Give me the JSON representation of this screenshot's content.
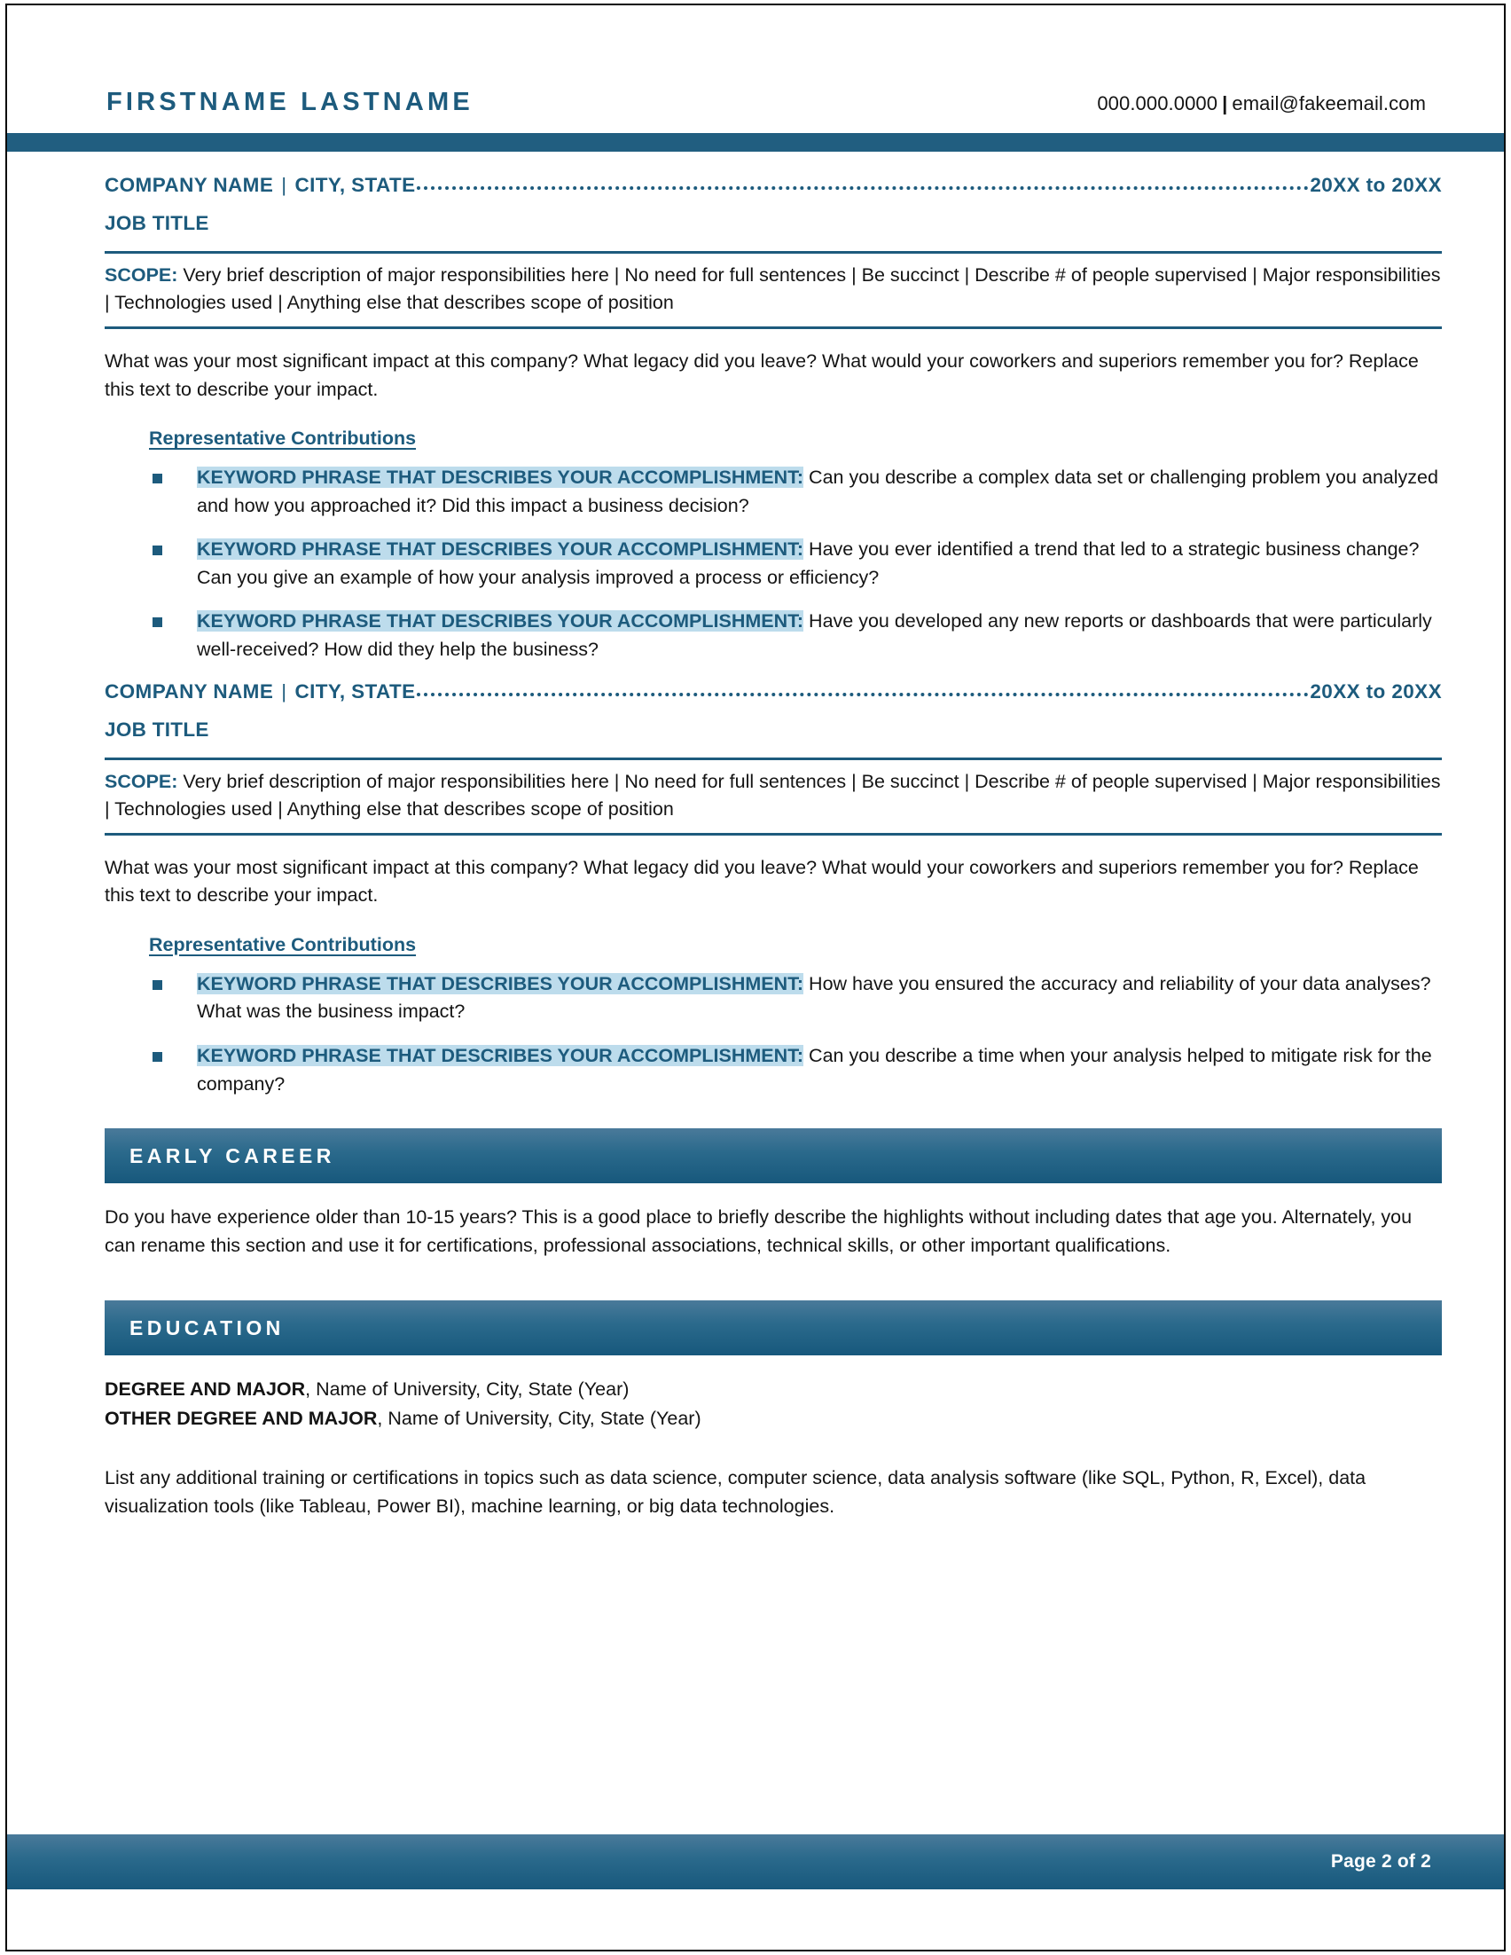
{
  "header": {
    "full_name": "FIRSTNAME LASTNAME",
    "phone": "000.000.0000",
    "separator": "|",
    "email": "email@fakeemail.com",
    "accent_color": "#215e80"
  },
  "jobs": [
    {
      "company_name": "COMPANY NAME",
      "pipe": "|",
      "city_state": "CITY, STATE",
      "dates": "20XX to 20XX",
      "job_title": "JOB TITLE",
      "scope_label": "SCOPE:",
      "scope_text": " Very brief description of major responsibilities here | No need for full sentences | Be succinct | Describe # of people supervised | Major responsibilities | Technologies used | Anything else that describes scope of position",
      "impact_paragraph": "What was your most significant impact at this company? What legacy did you leave? What would your coworkers and superiors remember you for? Replace this text to describe your impact.",
      "contributions_heading": "Representative Contributions",
      "bullets": [
        {
          "keyword": "KEYWORD PHRASE THAT DESCRIBES YOUR ACCOMPLISHMENT:",
          "text": " Can you describe a complex data set or challenging problem you analyzed and how you approached it? Did this impact a business decision?"
        },
        {
          "keyword": "KEYWORD PHRASE THAT DESCRIBES YOUR ACCOMPLISHMENT:",
          "text": " Have you ever identified a trend that led to a strategic business change? Can you give an example of how your analysis improved a process or efficiency?"
        },
        {
          "keyword": "KEYWORD PHRASE THAT DESCRIBES YOUR ACCOMPLISHMENT:",
          "text": " Have you developed any new reports or dashboards that were particularly well-received? How did they help the business?"
        }
      ]
    },
    {
      "company_name": "COMPANY NAME",
      "pipe": "|",
      "city_state": "CITY, STATE",
      "dates": "20XX to 20XX",
      "job_title": "JOB TITLE",
      "scope_label": "SCOPE:",
      "scope_text": " Very brief description of major responsibilities here | No need for full sentences | Be succinct | Describe # of people supervised | Major responsibilities | Technologies used | Anything else that describes scope of position",
      "impact_paragraph": "What was your most significant impact at this company? What legacy did you leave? What would your coworkers and superiors remember you for? Replace this text to describe your impact.",
      "contributions_heading": "Representative Contributions",
      "bullets": [
        {
          "keyword": "KEYWORD PHRASE THAT DESCRIBES YOUR ACCOMPLISHMENT:",
          "text": " How have you ensured the accuracy and reliability of your data analyses? What was the business impact?"
        },
        {
          "keyword": "KEYWORD PHRASE THAT DESCRIBES YOUR ACCOMPLISHMENT:",
          "text": " Can you describe a time when your analysis helped to mitigate risk for the company?"
        }
      ]
    }
  ],
  "early_career": {
    "title": "EARLY CAREER",
    "body": "Do you have experience older than 10-15 years? This is a good place to briefly describe the highlights without including dates that age you. Alternately, you can rename this section and use it for certifications, professional associations, technical skills, or other important qualifications."
  },
  "education": {
    "title": "EDUCATION",
    "entries": [
      {
        "degree": "DEGREE AND MAJOR",
        "detail": ", Name of University, City, State (Year)"
      },
      {
        "degree": "OTHER DEGREE AND MAJOR",
        "detail": ", Name of University, City, State (Year)"
      }
    ],
    "note": "List any additional training or certifications  in topics such as data science, computer science, data analysis software (like SQL, Python, R, Excel), data visualization tools (like Tableau, Power BI), machine learning, or big data technologies."
  },
  "footer": {
    "page_number": "Page 2 of 2"
  }
}
